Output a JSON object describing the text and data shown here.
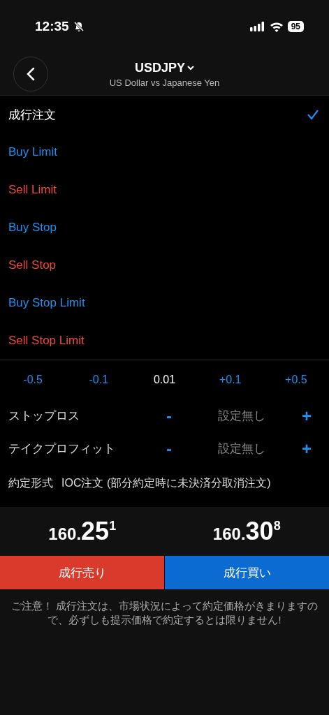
{
  "status_bar": {
    "time": "12:35",
    "battery": "95"
  },
  "header": {
    "symbol": "USDJPY",
    "description": "US Dollar vs Japanese Yen"
  },
  "order_types": [
    {
      "label": "成行注文",
      "kind": "market",
      "selected": true
    },
    {
      "label": "Buy Limit",
      "kind": "buy",
      "selected": false
    },
    {
      "label": "Sell Limit",
      "kind": "sell",
      "selected": false
    },
    {
      "label": "Buy Stop",
      "kind": "buy",
      "selected": false
    },
    {
      "label": "Sell Stop",
      "kind": "sell",
      "selected": false
    },
    {
      "label": "Buy Stop Limit",
      "kind": "buy",
      "selected": false
    },
    {
      "label": "Sell Stop Limit",
      "kind": "sell",
      "selected": false
    }
  ],
  "volume": {
    "steps_down": [
      "-0.5",
      "-0.1"
    ],
    "value": "0.01",
    "steps_up": [
      "+0.1",
      "+0.5"
    ]
  },
  "levels": [
    {
      "label": "ストップロス",
      "value": "設定無し",
      "minus": "-",
      "plus": "+"
    },
    {
      "label": "テイクプロフィット",
      "value": "設定無し",
      "minus": "-",
      "plus": "+"
    }
  ],
  "execution": {
    "label": "約定形式",
    "value": "IOC注文 (部分約定時に未決済分取消注文)"
  },
  "prices": [
    {
      "head": "160.",
      "big": "25",
      "pip": "1"
    },
    {
      "head": "160.",
      "big": "30",
      "pip": "8"
    }
  ],
  "buttons": [
    {
      "label": "成行売り",
      "kind": "sell"
    },
    {
      "label": "成行買い",
      "kind": "buy"
    }
  ],
  "notice": "ご注意！ 成行注文は、市場状況によって約定価格がきまりますので、必ずしも提示価格で約定するとは限りません!"
}
